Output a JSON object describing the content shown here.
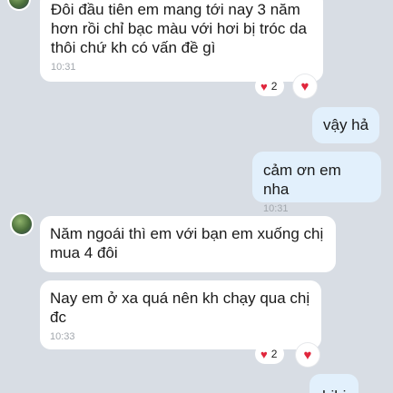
{
  "messages": [
    {
      "text": "Đôi đầu tiên em mang tới nay 3 năm hơn rồi chỉ bạc màu với hơi bị tróc da thôi chứ kh có vấn đề gì",
      "time": "10:31"
    },
    {
      "text": "vậy hả"
    },
    {
      "text": "cảm ơn em nha",
      "time": "10:31"
    },
    {
      "text": "Năm ngoái thì em với bạn em xuống chị mua 4 đôi"
    },
    {
      "text": "Nay em ở xa quá nên kh chạy qua chị đc",
      "time": "10:33"
    },
    {
      "text": "hihi"
    }
  ],
  "reactions": [
    {
      "count": "2"
    },
    {
      "count": "2"
    }
  ],
  "icons": {
    "reaction": "heart-icon",
    "avatar": "contact-avatar"
  },
  "colors": {
    "background": "#d8dde4",
    "incoming": "#ffffff",
    "outgoing": "#e2f0fc",
    "heart": "#e0263c"
  }
}
